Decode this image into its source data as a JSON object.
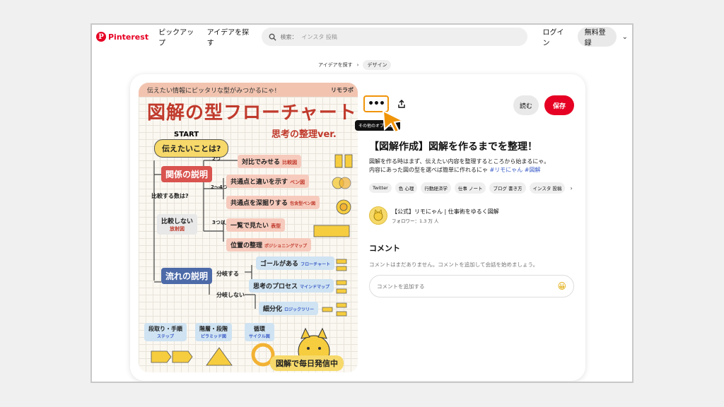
{
  "header": {
    "logo_text": "Pinterest",
    "logo_letter": "P",
    "nav": [
      "ピックアップ",
      "アイデアを探す"
    ],
    "search_label": "検索：",
    "search_placeholder": "インスタ 投稿",
    "login": "ログイン",
    "signup": "無料登録",
    "chevron": "⌄"
  },
  "breadcrumb": {
    "items": [
      "アイデアを探す",
      "デザイン"
    ],
    "sep": "›"
  },
  "pin_image": {
    "top_text": "伝えたい情報にピッタリな型がみつかるにゃ!",
    "brand_tag": "リモラボ",
    "big_title": "図解の型フローチャート",
    "subtitle": "思考の整理ver.",
    "start": "START",
    "question": "伝えたいことは?",
    "nodes": {
      "relation": "関係の説明",
      "compare_count": "比較する数は?",
      "two": "2つ",
      "two_four": "2〜4つ",
      "three_plus": "3つ以上",
      "compare_contrast": "対比でみせる",
      "compare_contrast_tag": "比較図",
      "venn_show": "共通点と違いを示す",
      "venn_tag": "ベン図",
      "venn_deep": "共通点を深掘りする",
      "venn_deep_tag": "包含型ベン図",
      "list_view": "一覧で見たい",
      "list_tag": "表型",
      "position": "位置の整理",
      "position_tag": "ポジショニングマップ",
      "no_compare": "比較しない",
      "radial": "放射図",
      "flow": "流れの説明",
      "branch": "分岐する",
      "no_branch": "分岐しない",
      "goal": "ゴールがある",
      "flowchart_tag": "フローチャート",
      "thinking": "思考のプロセス",
      "mindmap_tag": "マインドマップ",
      "detail": "細分化",
      "logic_tag": "ロジックツリー",
      "steps": "段取り・手順",
      "steps_tag": "ステップ",
      "hierarchy": "階層・段階",
      "hierarchy_tag": "ピラミッド図",
      "cycle": "循環",
      "cycle_tag": "サイクル図"
    },
    "footer": "図解で毎日発信中"
  },
  "actions": {
    "more": "•••",
    "share_icon": "share-icon",
    "tooltip": "その他のオプション",
    "read": "読む",
    "save": "保存"
  },
  "pin": {
    "title": "【図解作成】図解を作るまでを整理！",
    "desc_line1": "図解を作る時はまず、伝えたい内容を整理するところから始まるにゃ。",
    "desc_line2": "内容にあった図の型を選べば簡単に作れるにゃ",
    "hashtags": "#リモにゃん #図解",
    "tags": [
      "Twitter",
      "色 心理",
      "行動経済学",
      "仕事 ノート",
      "ブログ 書き方",
      "インスタ 投稿"
    ]
  },
  "creator": {
    "name": "【公式】リモにゃん | 仕事術をゆるく図解",
    "followers": "フォロワー：1.3 万 人"
  },
  "comments": {
    "heading": "コメント",
    "empty": "コメントはまだありません。コメントを追加して会話を始めましょう。",
    "placeholder": "コメントを追加する",
    "emoji": "😀"
  },
  "colors": {
    "brand": "#e60023",
    "highlight": "#f0940a"
  }
}
